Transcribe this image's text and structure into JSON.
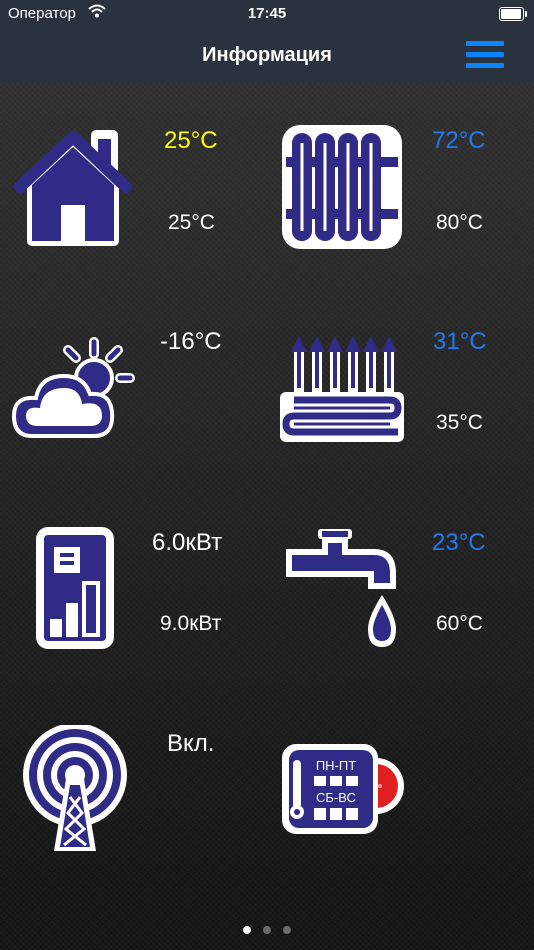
{
  "status": {
    "carrier": "Оператор",
    "time": "17:45"
  },
  "nav": {
    "title": "Информация",
    "menu_icon": "hamburger-menu-icon",
    "accent": "#0a84ff"
  },
  "tiles": {
    "indoor": {
      "icon": "house-icon",
      "value": "25°C",
      "value_color": "#ffff00",
      "setpoint": "25°C"
    },
    "radiator": {
      "icon": "radiator-icon",
      "value": "72°C",
      "value_color": "#1e7bf0",
      "setpoint": "80°C"
    },
    "outdoor": {
      "icon": "cloud-sun-icon",
      "value": "-16°C",
      "value_color": "#ffffff"
    },
    "floor": {
      "icon": "floor-heating-icon",
      "value": "31°C",
      "value_color": "#1e7bf0",
      "setpoint": "35°C"
    },
    "power": {
      "icon": "power-meter-icon",
      "value": "6.0кВт",
      "value_color": "#ffffff",
      "setpoint": "9.0кВт"
    },
    "water": {
      "icon": "water-tap-icon",
      "value": "23°C",
      "value_color": "#1e7bf0",
      "setpoint": "60°C"
    },
    "signal": {
      "icon": "antenna-tower-icon",
      "value": "Вкл.",
      "value_color": "#ffffff"
    },
    "schedule": {
      "icon": "schedule-icon",
      "weekday_label": "ПН-ПТ",
      "weekend_label": "СБ-ВС"
    }
  },
  "pagination": {
    "pages": 3,
    "active_page": 1
  }
}
